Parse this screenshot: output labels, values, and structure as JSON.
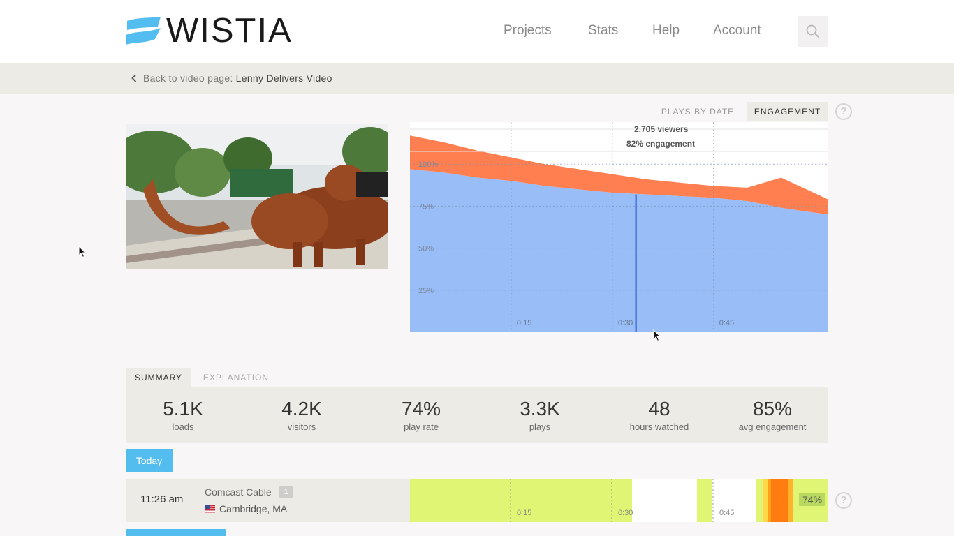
{
  "brand": {
    "name": "WISTIA",
    "colors": {
      "logo_blue": "#54bdf0",
      "primary": "#54bdf0",
      "engagement_fill": "#98bdf7",
      "rewatch_fill": "#ff7f50"
    }
  },
  "nav": {
    "items": [
      {
        "label": "Projects"
      },
      {
        "label": "Stats"
      },
      {
        "label": "Help"
      },
      {
        "label": "Account"
      }
    ],
    "search_icon": "search-icon"
  },
  "breadcrumb": {
    "prefix": "Back to video page:",
    "video_title": "Lenny Delivers Video"
  },
  "view_tabs": {
    "plays_by_date": "PLAYS BY DATE",
    "engagement": "ENGAGEMENT",
    "active": "engagement",
    "help": "?"
  },
  "engagement_chart": {
    "tooltip": {
      "viewers": "2,705 viewers",
      "engagement": "82% engagement"
    },
    "y_ticks": [
      "100%",
      "75%",
      "50%",
      "25%"
    ],
    "x_ticks": [
      "0:15",
      "0:30",
      "0:45"
    ]
  },
  "chart_data": {
    "type": "area",
    "x": [
      0,
      5,
      10,
      15,
      20,
      25,
      30,
      35,
      40,
      45,
      50,
      55,
      62
    ],
    "series": [
      {
        "values": [
          97,
          95,
          92,
          90,
          87,
          85,
          83,
          82,
          81,
          80,
          78,
          74,
          70
        ]
      },
      {
        "values": [
          117,
          113,
          108,
          104,
          100,
          97,
          94,
          91,
          89,
          87,
          86,
          92,
          79
        ]
      }
    ],
    "x_ticks": [
      "0:15",
      "0:30",
      "0:45"
    ],
    "y_ticks": [
      "100%",
      "75%",
      "50%",
      "25%"
    ],
    "ylim": [
      0,
      125
    ],
    "grid": true
  },
  "summary_tabs": {
    "summary": "SUMMARY",
    "explanation": "EXPLANATION",
    "active": "summary"
  },
  "stats": [
    {
      "value": "5.1K",
      "label": "loads"
    },
    {
      "value": "4.2K",
      "label": "visitors"
    },
    {
      "value": "74%",
      "label": "play rate"
    },
    {
      "value": "3.3K",
      "label": "plays"
    },
    {
      "value": "48",
      "label": "hours watched"
    },
    {
      "value": "85%",
      "label": "avg engagement"
    }
  ],
  "sessions": {
    "group_label": "Today",
    "rows": [
      {
        "time": "11:26 am",
        "isp": "Comcast Cable",
        "count": "1",
        "location": "Cambridge, MA",
        "engagement": "74%",
        "x_ticks": [
          "0:15",
          "0:30",
          "0:45"
        ]
      }
    ],
    "help": "?"
  }
}
